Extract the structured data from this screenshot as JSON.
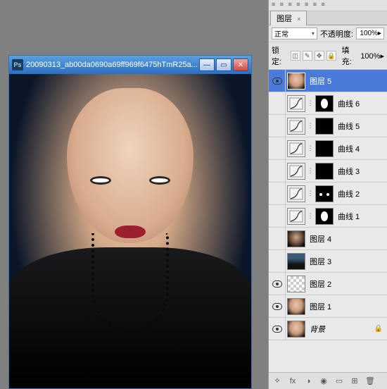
{
  "document": {
    "titlebar_icon": "Ps",
    "title": "20090313_ab00da0690a69ff969f6475hTmR25a..."
  },
  "panel": {
    "menu_glyphs": "≡ ≡ ≡ ≡ ≡ ≡ ≡",
    "tab_label": "图层",
    "tab_close": "×",
    "blend_mode": "正常",
    "opacity_label": "不透明度:",
    "opacity_value": "100%",
    "lock_label": "锁定:",
    "fill_label": "填充:",
    "fill_value": "100%"
  },
  "layers": [
    {
      "name": "图层 5",
      "type": "image",
      "thumb": "face",
      "selected": true,
      "visible": true,
      "mask": null
    },
    {
      "name": "曲线 6",
      "type": "curves",
      "thumb": "curves-icon",
      "visible": false,
      "mask": "blob"
    },
    {
      "name": "曲线 5",
      "type": "curves",
      "thumb": "curves-icon",
      "visible": false,
      "mask": "blank"
    },
    {
      "name": "曲线 4",
      "type": "curves",
      "thumb": "curves-icon",
      "visible": false,
      "mask": "blank"
    },
    {
      "name": "曲线 3",
      "type": "curves",
      "thumb": "curves-icon",
      "visible": false,
      "mask": "blank"
    },
    {
      "name": "曲线 2",
      "type": "curves",
      "thumb": "curves-icon",
      "visible": false,
      "mask": "dots"
    },
    {
      "name": "曲线 1",
      "type": "curves",
      "thumb": "curves-icon",
      "visible": false,
      "mask": "blob"
    },
    {
      "name": "图层 4",
      "type": "image",
      "thumb": "face dark",
      "visible": false,
      "mask": null
    },
    {
      "name": "图层 3",
      "type": "image",
      "thumb": "body",
      "visible": false,
      "mask": null
    },
    {
      "name": "图层 2",
      "type": "image",
      "thumb": "checker",
      "visible": true,
      "mask": null
    },
    {
      "name": "图层 1",
      "type": "image",
      "thumb": "face",
      "visible": true,
      "mask": null
    },
    {
      "name": "背景",
      "type": "image",
      "thumb": "face",
      "visible": true,
      "mask": null,
      "locked": true
    }
  ],
  "footer_icons": [
    "⟡",
    "fx",
    "◑",
    "◉",
    "▭",
    "⊞",
    "🗑"
  ]
}
